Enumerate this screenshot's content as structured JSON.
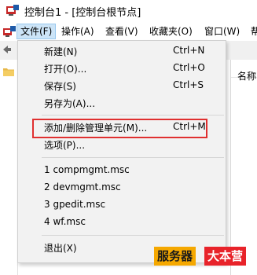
{
  "window": {
    "title": "控制台1 - [控制台根节点]"
  },
  "menubar": {
    "items": [
      {
        "label": "文件(F)",
        "active": true
      },
      {
        "label": "操作(A)",
        "active": false
      },
      {
        "label": "查看(V)",
        "active": false
      },
      {
        "label": "收藏夹(O)",
        "active": false
      },
      {
        "label": "窗口(W)",
        "active": false
      },
      {
        "label": "帮",
        "active": false
      }
    ]
  },
  "right_pane": {
    "column_header": "名称"
  },
  "file_menu": {
    "items": [
      {
        "label": "新建(N)",
        "shortcut": "Ctrl+N"
      },
      {
        "label": "打开(O)...",
        "shortcut": "Ctrl+O"
      },
      {
        "label": "保存(S)",
        "shortcut": "Ctrl+S"
      },
      {
        "label": "另存为(A)...",
        "shortcut": ""
      },
      {
        "label": "添加/删除管理单元(M)...",
        "shortcut": "Ctrl+M",
        "highlighted": true
      },
      {
        "label": "选项(P)...",
        "shortcut": ""
      },
      {
        "label": "1 compmgmt.msc",
        "shortcut": ""
      },
      {
        "label": "2 devmgmt.msc",
        "shortcut": ""
      },
      {
        "label": "3 gpedit.msc",
        "shortcut": ""
      },
      {
        "label": "4 wf.msc",
        "shortcut": ""
      },
      {
        "label": "退出(X)",
        "shortcut": ""
      }
    ]
  },
  "watermark": {
    "part1": "服务器",
    "part2": "大本营"
  },
  "colors": {
    "menu_active_bg": "#cce4f7",
    "highlight_border": "#e03030",
    "watermark_yellow": "#f5a800",
    "watermark_red": "#e8232a"
  }
}
